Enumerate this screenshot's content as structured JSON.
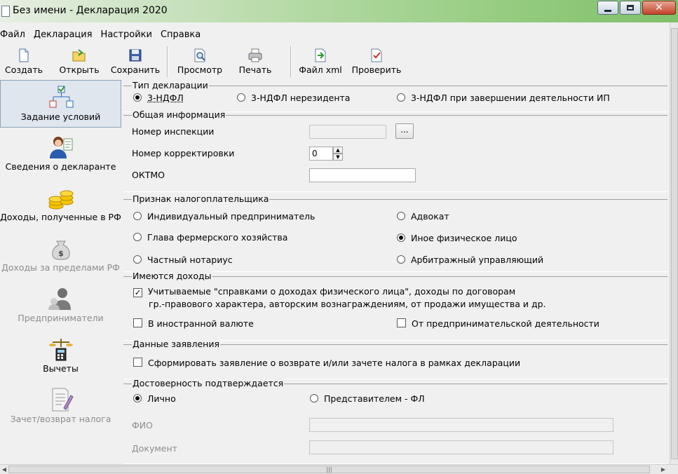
{
  "window": {
    "title": "Без имени - Декларация 2020",
    "min_icon": "minimize-icon",
    "max_icon": "maximize-icon",
    "close_icon": "close-icon"
  },
  "menu": [
    "Файл",
    "Декларация",
    "Настройки",
    "Справка"
  ],
  "toolbar": {
    "create": "Создать",
    "open": "Открыть",
    "save": "Сохранить",
    "preview": "Просмотр",
    "print": "Печать",
    "xml": "Файл xml",
    "check": "Проверить"
  },
  "sidebar": [
    {
      "label": "Задание условий",
      "icon": "conditions-tree-icon",
      "active": true,
      "enabled": true
    },
    {
      "label": "Сведения о декларанте",
      "icon": "declarant-person-icon",
      "enabled": true
    },
    {
      "label": "Доходы, полученные в РФ",
      "icon": "coins-icon",
      "enabled": true
    },
    {
      "label": "Доходы за пределами РФ",
      "icon": "money-bag-icon",
      "enabled": false
    },
    {
      "label": "Предприниматели",
      "icon": "entrepreneur-icon",
      "enabled": false
    },
    {
      "label": "Вычеты",
      "icon": "scales-calculator-icon",
      "enabled": true
    },
    {
      "label": "Зачет/возврат налога",
      "icon": "document-pen-icon",
      "enabled": false
    }
  ],
  "decl_type": {
    "title": "Тип декларации",
    "options": [
      "3-НДФЛ",
      "3-НДФЛ нерезидента",
      "3-НДФЛ при завершении деятельности ИП"
    ],
    "selected": "3-НДФЛ"
  },
  "general": {
    "title": "Общая информация",
    "inspection_label": "Номер инспекции",
    "inspection_value": "",
    "browse": "...",
    "correction_label": "Номер корректировки",
    "correction_value": "0",
    "oktmo_label": "ОКТМО",
    "oktmo_value": ""
  },
  "taxpayer": {
    "title": "Признак налогоплательщика",
    "options": [
      "Индивидуальный предприниматель",
      "Адвокат",
      "Глава фермерского хозяйства",
      "Иное физическое лицо",
      "Частный нотариус",
      "Арбитражный управляющий"
    ],
    "selected": "Иное физическое лицо"
  },
  "incomes": {
    "title": "Имеются доходы",
    "main_line1": "Учитываемые \"справками о доходах физического лица\", доходы по договорам",
    "main_line2": "гр.-правового характера, авторским вознаграждениям, от продажи имущества и др.",
    "main_checked": true,
    "foreign": "В иностранной валюте",
    "foreign_checked": false,
    "business": "От предпринимательской деятельности",
    "business_checked": false
  },
  "application": {
    "title": "Данные заявления",
    "label": "Сформировать заявление о  возврате и/или зачете налога в рамках декларации",
    "checked": false
  },
  "confirm": {
    "title": "Достоверность подтверждается",
    "personal": "Лично",
    "representative": "Представителем - ФЛ",
    "selected": "Лично",
    "fio_label": "ФИО",
    "fio_value": "",
    "doc_label": "Документ",
    "doc_value": ""
  }
}
